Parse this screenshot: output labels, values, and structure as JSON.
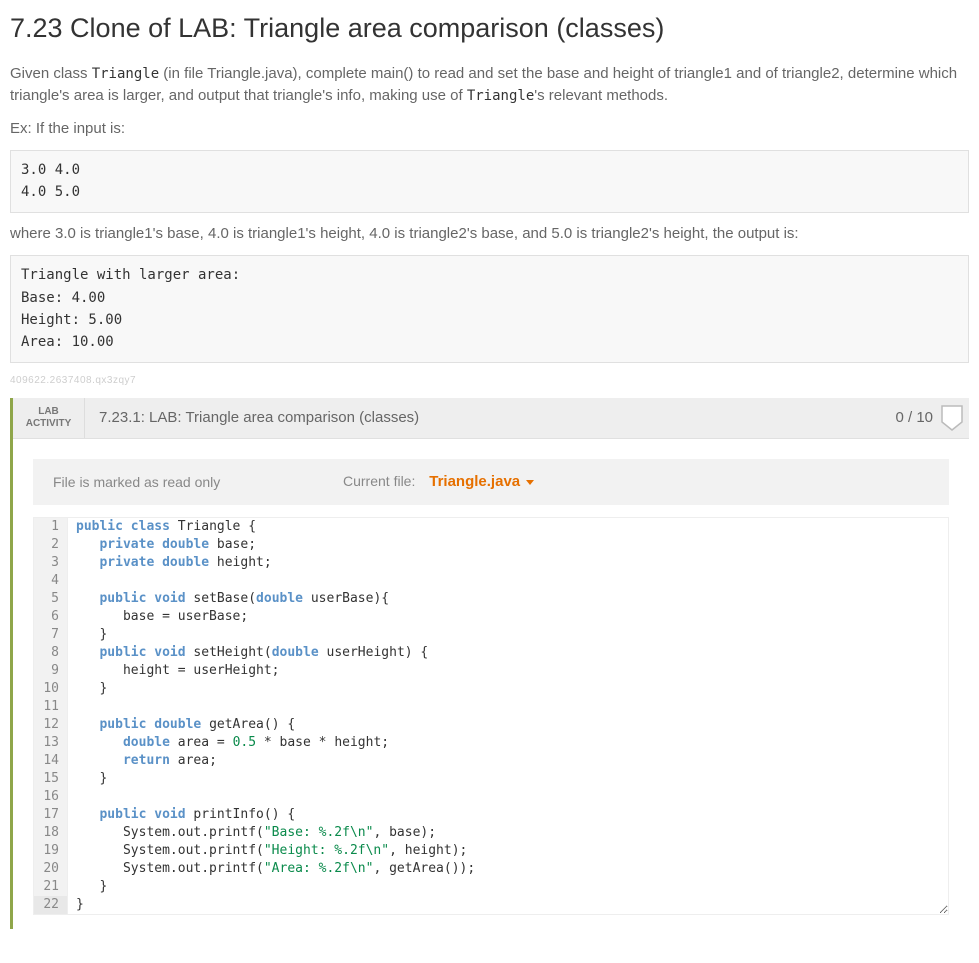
{
  "title": "7.23 Clone of LAB: Triangle area comparison (classes)",
  "intro_parts": {
    "p1a": "Given class ",
    "class1": "Triangle",
    "p1b": " (in file Triangle.java), complete main() to read and set the base and height of triangle1 and of triangle2, determine which triangle's area is larger, and output that triangle's info, making use of ",
    "class2": "Triangle",
    "p1c": "'s relevant methods."
  },
  "example_label": "Ex: If the input is:",
  "example_input": "3.0 4.0\n4.0 5.0",
  "example_explain": "where 3.0 is triangle1's base, 4.0 is triangle1's height, 4.0 is triangle2's base, and 5.0 is triangle2's height, the output is:",
  "example_output": "Triangle with larger area:\nBase: 4.00\nHeight: 5.00\nArea: 10.00",
  "small_id": "409622.2637408.qx3zqy7",
  "activity": {
    "tag_line1": "LAB",
    "tag_line2": "ACTIVITY",
    "title": "7.23.1: LAB: Triangle area comparison (classes)",
    "score": "0 / 10"
  },
  "filebar": {
    "readonly": "File is marked as read only",
    "current_label": "Current file:",
    "current_file": "Triangle.java"
  },
  "code": [
    {
      "n": 1,
      "t": [
        [
          "kw",
          "public"
        ],
        [
          "sp",
          " "
        ],
        [
          "kw",
          "class"
        ],
        [
          "sp",
          " "
        ],
        [
          "cls",
          "Triangle"
        ],
        [
          "sp",
          " "
        ],
        [
          "p",
          "{"
        ]
      ]
    },
    {
      "n": 2,
      "t": [
        [
          "sp",
          "   "
        ],
        [
          "kw",
          "private"
        ],
        [
          "sp",
          " "
        ],
        [
          "type",
          "double"
        ],
        [
          "sp",
          " "
        ],
        [
          "id",
          "base;"
        ]
      ]
    },
    {
      "n": 3,
      "t": [
        [
          "sp",
          "   "
        ],
        [
          "kw",
          "private"
        ],
        [
          "sp",
          " "
        ],
        [
          "type",
          "double"
        ],
        [
          "sp",
          " "
        ],
        [
          "id",
          "height;"
        ]
      ]
    },
    {
      "n": 4,
      "t": []
    },
    {
      "n": 5,
      "t": [
        [
          "sp",
          "   "
        ],
        [
          "kw",
          "public"
        ],
        [
          "sp",
          " "
        ],
        [
          "type",
          "void"
        ],
        [
          "sp",
          " "
        ],
        [
          "id",
          "setBase("
        ],
        [
          "type",
          "double"
        ],
        [
          "sp",
          " "
        ],
        [
          "id",
          "userBase){"
        ]
      ]
    },
    {
      "n": 6,
      "t": [
        [
          "sp",
          "      "
        ],
        [
          "id",
          "base = userBase;"
        ]
      ]
    },
    {
      "n": 7,
      "t": [
        [
          "sp",
          "   "
        ],
        [
          "p",
          "}"
        ]
      ]
    },
    {
      "n": 8,
      "t": [
        [
          "sp",
          "   "
        ],
        [
          "kw",
          "public"
        ],
        [
          "sp",
          " "
        ],
        [
          "type",
          "void"
        ],
        [
          "sp",
          " "
        ],
        [
          "id",
          "setHeight("
        ],
        [
          "type",
          "double"
        ],
        [
          "sp",
          " "
        ],
        [
          "id",
          "userHeight) {"
        ]
      ]
    },
    {
      "n": 9,
      "t": [
        [
          "sp",
          "      "
        ],
        [
          "id",
          "height = userHeight;"
        ]
      ]
    },
    {
      "n": 10,
      "t": [
        [
          "sp",
          "   "
        ],
        [
          "p",
          "}"
        ]
      ]
    },
    {
      "n": 11,
      "t": []
    },
    {
      "n": 12,
      "t": [
        [
          "sp",
          "   "
        ],
        [
          "kw",
          "public"
        ],
        [
          "sp",
          " "
        ],
        [
          "type",
          "double"
        ],
        [
          "sp",
          " "
        ],
        [
          "id",
          "getArea() {"
        ]
      ]
    },
    {
      "n": 13,
      "t": [
        [
          "sp",
          "      "
        ],
        [
          "type",
          "double"
        ],
        [
          "sp",
          " "
        ],
        [
          "id",
          "area = "
        ],
        [
          "num",
          "0.5"
        ],
        [
          "id",
          " * base * height;"
        ]
      ]
    },
    {
      "n": 14,
      "t": [
        [
          "sp",
          "      "
        ],
        [
          "kw",
          "return"
        ],
        [
          "sp",
          " "
        ],
        [
          "id",
          "area;"
        ]
      ]
    },
    {
      "n": 15,
      "t": [
        [
          "sp",
          "   "
        ],
        [
          "p",
          "}"
        ]
      ]
    },
    {
      "n": 16,
      "t": []
    },
    {
      "n": 17,
      "t": [
        [
          "sp",
          "   "
        ],
        [
          "kw",
          "public"
        ],
        [
          "sp",
          " "
        ],
        [
          "type",
          "void"
        ],
        [
          "sp",
          " "
        ],
        [
          "id",
          "printInfo() {"
        ]
      ]
    },
    {
      "n": 18,
      "t": [
        [
          "sp",
          "      "
        ],
        [
          "id",
          "System.out.printf("
        ],
        [
          "str",
          "\"Base: %.2f\\n\""
        ],
        [
          "id",
          ", base);"
        ]
      ]
    },
    {
      "n": 19,
      "t": [
        [
          "sp",
          "      "
        ],
        [
          "id",
          "System.out.printf("
        ],
        [
          "str",
          "\"Height: %.2f\\n\""
        ],
        [
          "id",
          ", height);"
        ]
      ]
    },
    {
      "n": 20,
      "t": [
        [
          "sp",
          "      "
        ],
        [
          "id",
          "System.out.printf("
        ],
        [
          "str",
          "\"Area: %.2f\\n\""
        ],
        [
          "id",
          ", getArea());"
        ]
      ]
    },
    {
      "n": 21,
      "t": [
        [
          "sp",
          "   "
        ],
        [
          "p",
          "}"
        ]
      ]
    },
    {
      "n": 22,
      "t": [
        [
          "p",
          "}"
        ]
      ]
    }
  ]
}
